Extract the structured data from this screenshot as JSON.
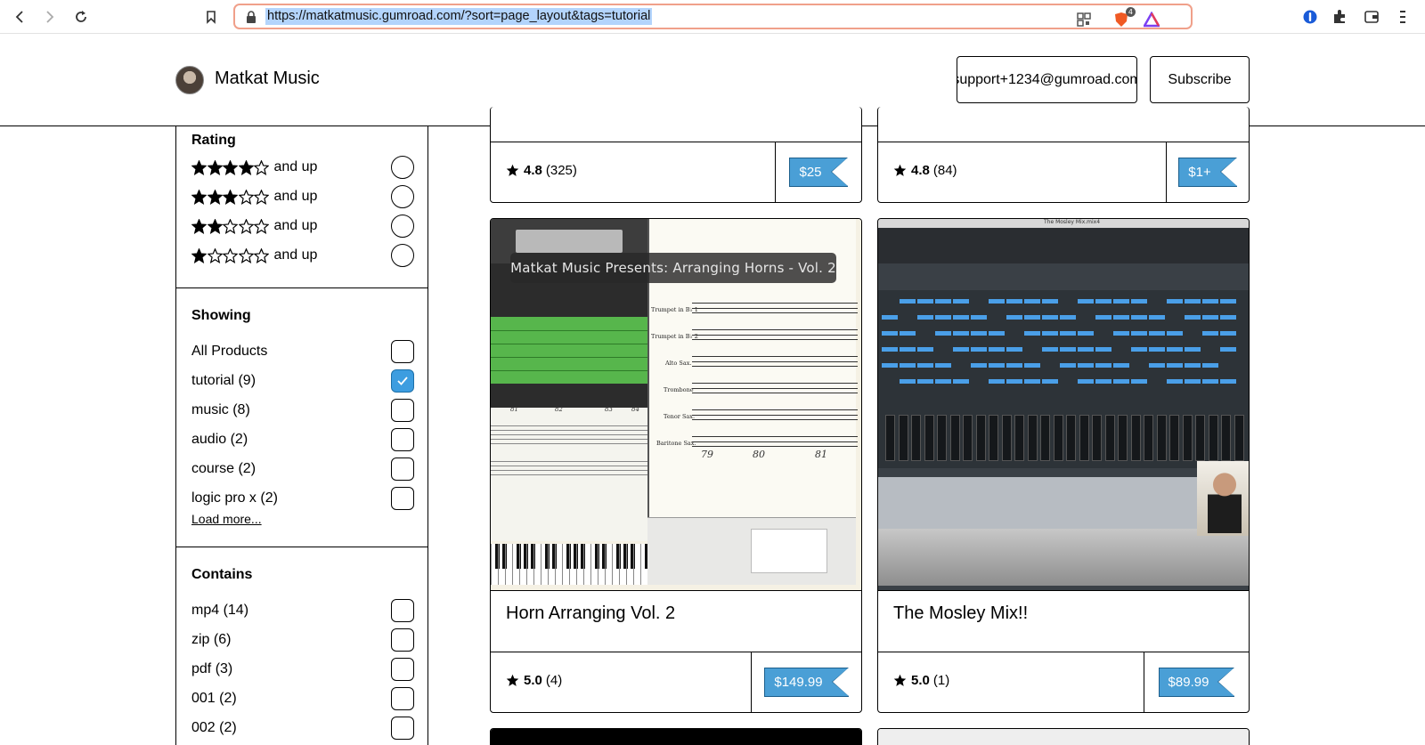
{
  "browser": {
    "url": "https://matkatmusic.gumroad.com/?sort=page_layout&tags=tutorial",
    "shields_count": "4"
  },
  "header": {
    "shop_name": "Matkat Music",
    "email_button": "support+1234@gumroad.com",
    "subscribe_button": "Subscribe"
  },
  "sidebar": {
    "rating": {
      "title": "Rating",
      "options": [
        {
          "stars": 4,
          "label": "and up"
        },
        {
          "stars": 3,
          "label": "and up"
        },
        {
          "stars": 2,
          "label": "and up"
        },
        {
          "stars": 1,
          "label": "and up"
        }
      ]
    },
    "showing": {
      "title": "Showing",
      "options": [
        {
          "label": "All Products",
          "checked": false
        },
        {
          "label": "tutorial (9)",
          "checked": true
        },
        {
          "label": "music (8)",
          "checked": false
        },
        {
          "label": "audio (2)",
          "checked": false
        },
        {
          "label": "course (2)",
          "checked": false
        },
        {
          "label": "logic pro x (2)",
          "checked": false
        }
      ],
      "load_more": "Load more..."
    },
    "contains": {
      "title": "Contains",
      "options": [
        {
          "label": "mp4 (14)",
          "checked": false
        },
        {
          "label": "zip (6)",
          "checked": false
        },
        {
          "label": "pdf (3)",
          "checked": false
        },
        {
          "label": "001 (2)",
          "checked": false
        },
        {
          "label": "002 (2)",
          "checked": false
        }
      ]
    }
  },
  "products": [
    {
      "title": "",
      "rating": "4.8",
      "reviews": "(325)",
      "price": "$25"
    },
    {
      "title": "",
      "rating": "4.8",
      "reviews": "(84)",
      "price": "$1+"
    },
    {
      "title": "Horn Arranging Vol. 2",
      "rating": "5.0",
      "reviews": "(4)",
      "price": "$149.99",
      "thumbnail": {
        "overlay_text": "Matkat Music Presents: Arranging Horns - Vol. 2",
        "instruments": [
          "Trumpet in B♭ 1",
          "Trumpet in B♭ 2",
          "Alto Sax.",
          "Trombone",
          "Tenor Sax.",
          "Baritone Sax."
        ],
        "bars": [
          "79",
          "80",
          "81"
        ],
        "piano_bars": [
          "81",
          "82",
          "83",
          "84"
        ]
      }
    },
    {
      "title": "The Mosley Mix!!",
      "rating": "5.0",
      "reviews": "(1)",
      "price": "$89.99",
      "thumbnail": {
        "window_title": "The Mosley Mix.mix4"
      }
    }
  ],
  "colors": {
    "accent": "#4a9fd6",
    "checkbox_checked": "#3d9de0",
    "url_highlight": "#b3d4fc",
    "url_border": "#f0a08a"
  },
  "icons": [
    "back-icon",
    "forward-icon",
    "reload-icon",
    "bookmark-icon",
    "lock-icon",
    "qr-icon",
    "brave-shields-icon",
    "brave-rewards-icon",
    "password-manager-icon",
    "extensions-icon",
    "wallet-icon",
    "menu-icon",
    "star-icon",
    "check-icon"
  ]
}
